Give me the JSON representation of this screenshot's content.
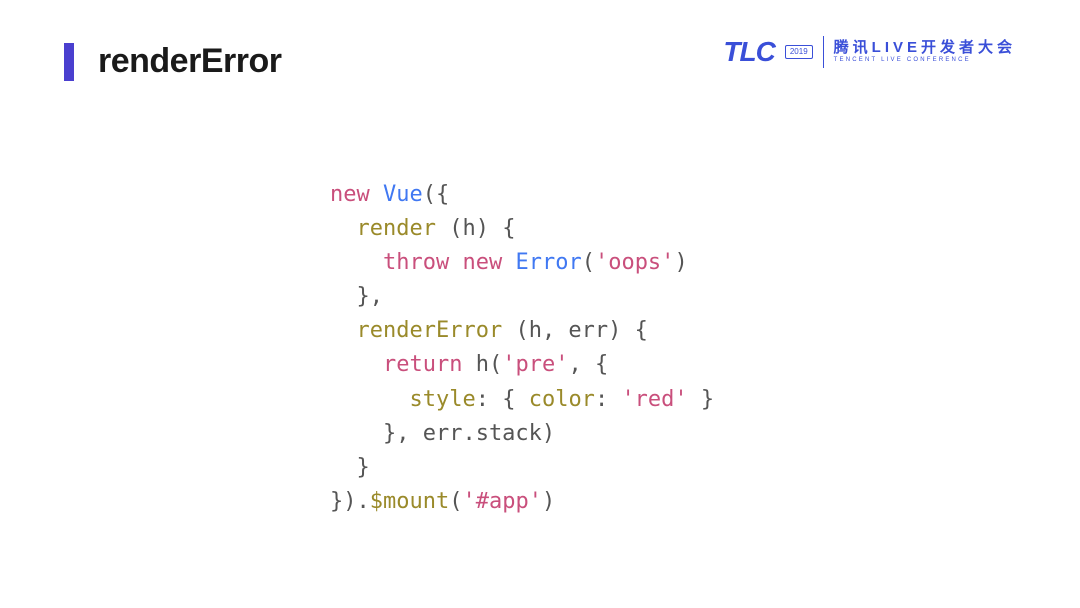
{
  "title": "renderError",
  "logo": {
    "brand": "TLC",
    "badge": "2019",
    "cnMain": "腾讯LIVE开发者大会",
    "cnSub": "TENCENT LIVE CONFERENCE"
  },
  "code": {
    "t1a": "new",
    "t1b": " ",
    "t1c": "Vue",
    "t1d": "({",
    "t2a": "  ",
    "t2b": "render",
    "t2c": " (h) {",
    "t3a": "    ",
    "t3b": "throw",
    "t3c": " ",
    "t3d": "new",
    "t3e": " ",
    "t3f": "Error",
    "t3g": "(",
    "t3h": "'oops'",
    "t3i": ")",
    "t4a": "  },",
    "t5a": "  ",
    "t5b": "renderError",
    "t5c": " (h, err) {",
    "t6a": "    ",
    "t6b": "return",
    "t6c": " h(",
    "t6d": "'pre'",
    "t6e": ", {",
    "t7a": "      ",
    "t7b": "style",
    "t7c": ": { ",
    "t7d": "color",
    "t7e": ": ",
    "t7f": "'red'",
    "t7g": " }",
    "t8a": "    }, err.stack)",
    "t9a": "  }",
    "t10a": "}).",
    "t10b": "$mount",
    "t10c": "(",
    "t10d": "'#app'",
    "t10e": ")"
  }
}
